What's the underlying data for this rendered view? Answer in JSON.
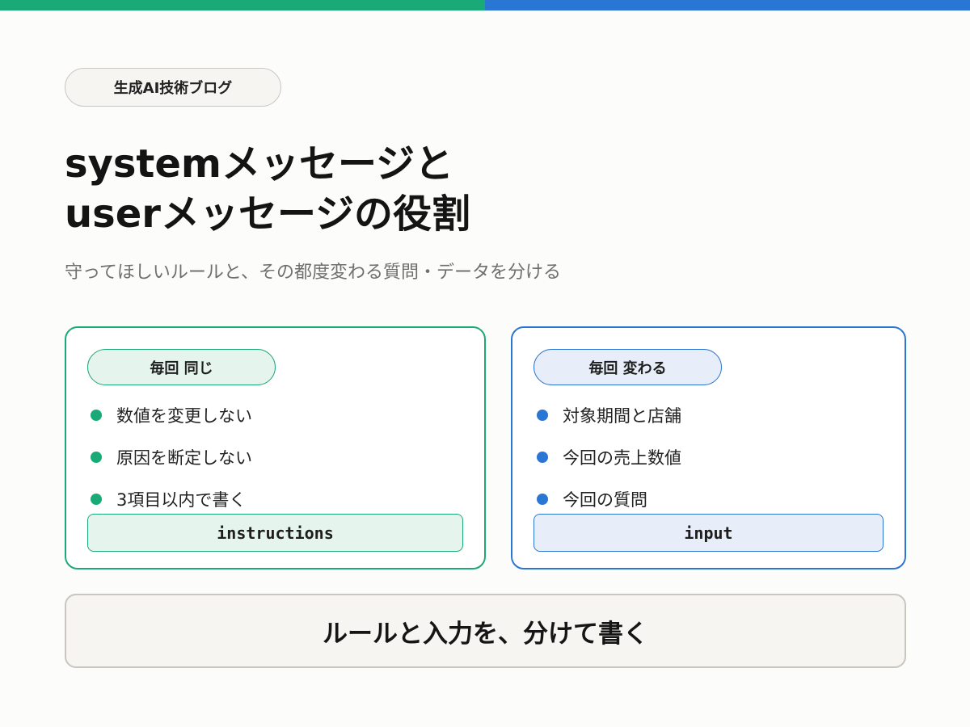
{
  "blog_label": "生成AI技術ブログ",
  "title": {
    "line1": "systemメッセージと",
    "line2": "userメッセージの役割"
  },
  "subtitle": "守ってほしいルールと、その都度変わる質問・データを分ける",
  "colors": {
    "green_accent": "#1aaa78",
    "blue_accent": "#2a76d4"
  },
  "left_card": {
    "tag": "毎回 同じ",
    "items": [
      "数値を変更しない",
      "原因を断定しない",
      "3項目以内で書く"
    ],
    "code": "instructions"
  },
  "right_card": {
    "tag": "毎回 変わる",
    "items": [
      "対象期間と店舗",
      "今回の売上数値",
      "今回の質問"
    ],
    "code": "input"
  },
  "summary": "ルールと入力を、分けて書く"
}
